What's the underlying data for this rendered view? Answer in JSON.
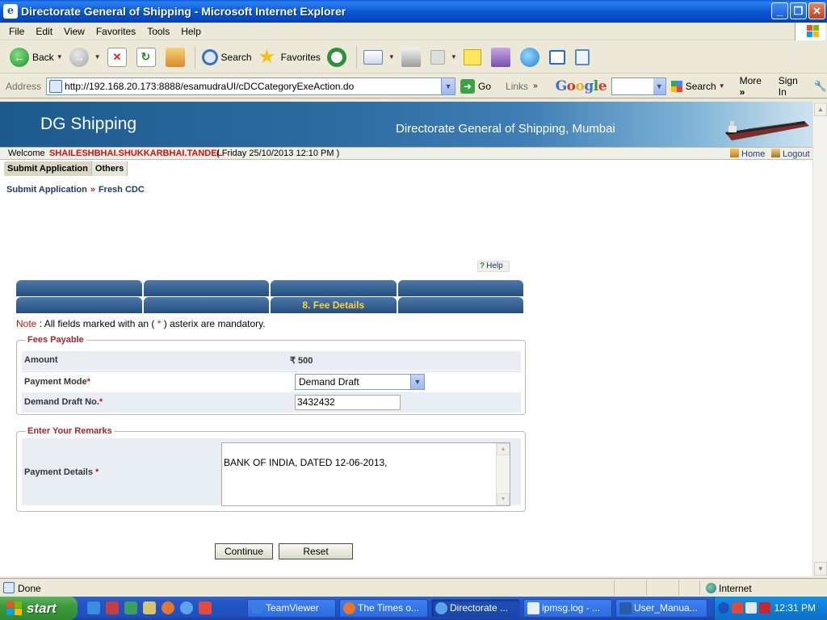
{
  "window": {
    "title": "Directorate General of Shipping - Microsoft Internet Explorer",
    "controls": [
      "minimize",
      "restore",
      "close"
    ]
  },
  "menubar": {
    "items": [
      "File",
      "Edit",
      "View",
      "Favorites",
      "Tools",
      "Help"
    ]
  },
  "toolbar": {
    "back_label": "Back",
    "search_label": "Search",
    "favorites_label": "Favorites"
  },
  "addressbar": {
    "label": "Address",
    "url": "http://192.168.20.173:8888/esamudraUI/cDCCategoryExeAction.do",
    "go_label": "Go",
    "links_label": "Links",
    "google_search_label": "Search",
    "more_label": "More",
    "signin_label": "Sign In",
    "google_logo": "Google"
  },
  "header": {
    "brand": "DG Shipping",
    "org_name": "Directorate General of Shipping, Mumbai",
    "welcome_label": "Welcome",
    "user_name": "SHAILESHBHAI.SHUKKARBHAI.TANDEL",
    "datetime": "( Friday 25/10/2013 12:10 PM )",
    "home_label": "Home",
    "logout_label": "Logout"
  },
  "tabs": [
    "Submit Application",
    "Others"
  ],
  "breadcrumb": {
    "items": [
      "Submit Application",
      "Fresh CDC"
    ],
    "separator": "»"
  },
  "help_label": "Help",
  "wizard": {
    "row1": [
      "",
      "",
      "",
      ""
    ],
    "row2": [
      "",
      "",
      "8. Fee Details",
      ""
    ]
  },
  "note": {
    "prefix": "Note",
    "text_before": " : All fields marked with an ( ",
    "star": "*",
    "text_after": " ) asterix are mandatory."
  },
  "fees_section": {
    "legend": "Fees Payable",
    "amount_label": "Amount",
    "amount_value": "₹ 500",
    "payment_mode_label": "Payment Mode",
    "payment_mode_value": "Demand Draft",
    "dd_no_label": "Demand Draft No.",
    "dd_no_value": "3432432"
  },
  "remarks_section": {
    "legend": "Enter Your Remarks",
    "payment_details_label": "Payment Details",
    "payment_details_value": "BANK OF INDIA, DATED 12-06-2013,"
  },
  "buttons": {
    "continue_label": "Continue",
    "reset_label": "Reset"
  },
  "statusbar": {
    "status_text": "Done",
    "zone_text": "Internet"
  },
  "taskbar": {
    "start_label": "start",
    "tasks": [
      "TeamViewer",
      "The Times o...",
      "Directorate ...",
      "ipmsg.log - ...",
      "User_Manua..."
    ],
    "active_task_index": 2,
    "clock": "12:31 PM"
  },
  "colors": {
    "banner": "#2c6aa0",
    "wizard_tab": "#355f91",
    "wizard_active_text": "#ffd23a",
    "required": "#d11212",
    "legend": "#a5262b",
    "label_shade": "#e9eef5"
  }
}
